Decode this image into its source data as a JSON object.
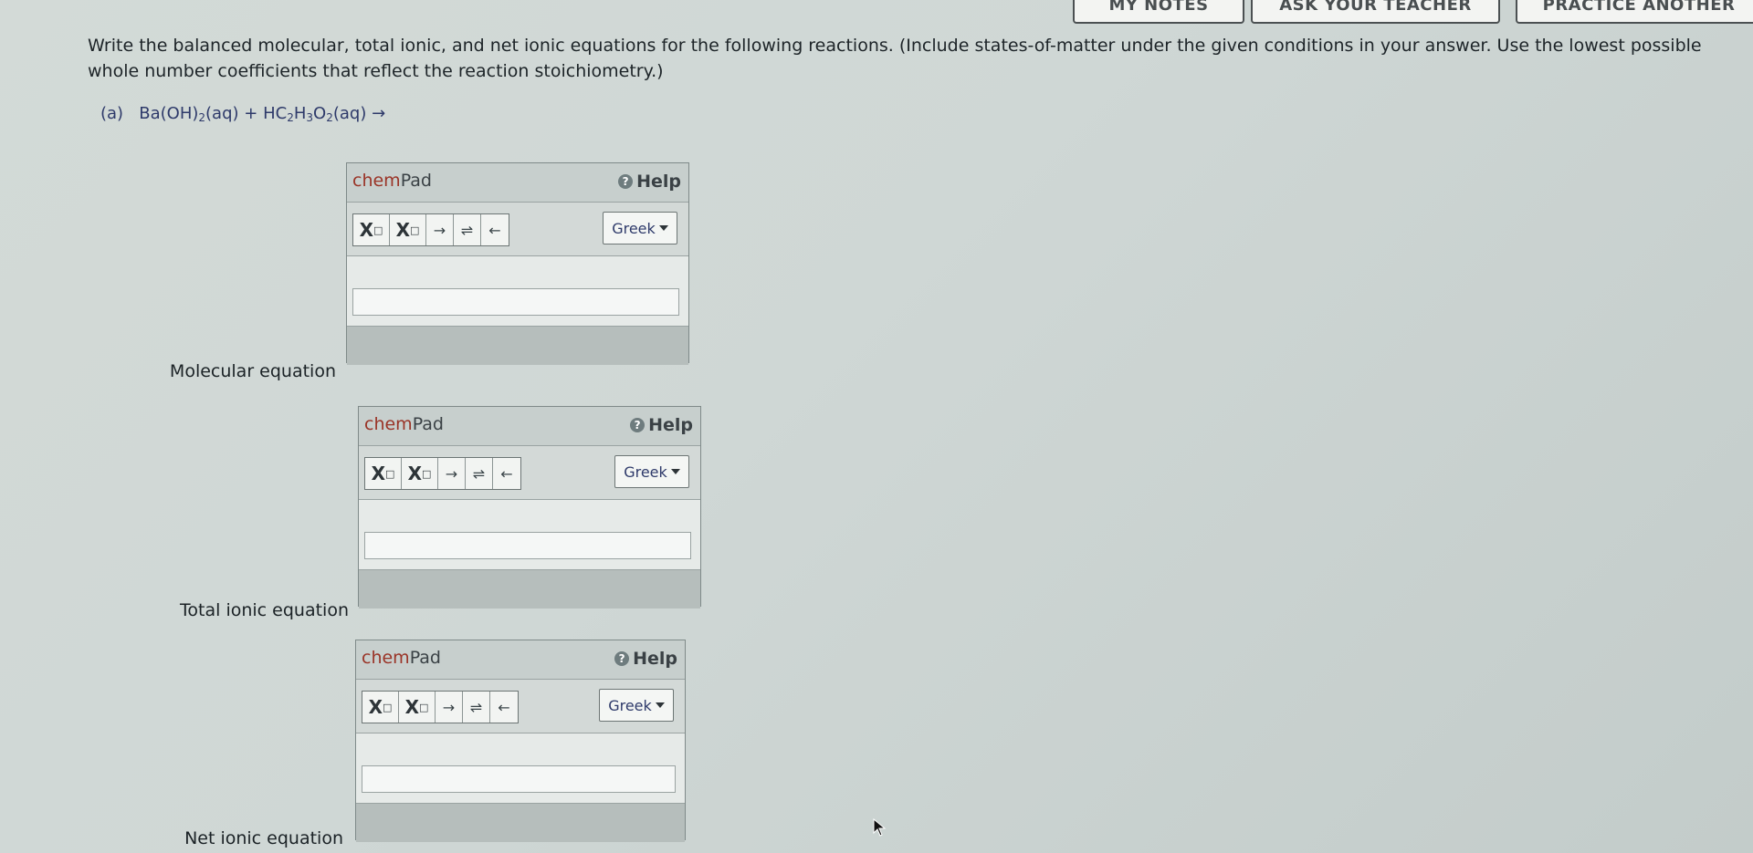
{
  "top_buttons": [
    {
      "label": "MY NOTES"
    },
    {
      "label": "ASK YOUR TEACHER"
    },
    {
      "label": "PRACTICE ANOTHER"
    }
  ],
  "question": {
    "instructions": "Write the balanced molecular, total ionic, and net ionic equations for the following reactions. (Include states-of-matter under the given conditions in your answer. Use the lowest possible whole number coefficients that reflect the reaction stoichiometry.)",
    "part_label": "(a)",
    "reaction": {
      "r1": "Ba(OH)",
      "r1_sub": "2",
      "r1_state": "(aq)",
      "plus": "+",
      "r2_a": "HC",
      "r2_sub1": "2",
      "r2_b": "H",
      "r2_sub2": "3",
      "r2_c": "O",
      "r2_sub3": "2",
      "r2_state": "(aq)",
      "arrow": "→"
    }
  },
  "chempad": {
    "title_chem": "chem",
    "title_pad": "Pad",
    "help_label": "Help",
    "help_icon": "question-circle-icon",
    "subscript_label": "X",
    "superscript_label": "X",
    "box_glyph": "□",
    "arrow_right": "→",
    "equilibrium": "⇌",
    "arrow_left": "←",
    "greek_label": "Greek"
  },
  "equations": [
    {
      "label": "Molecular equation",
      "value": ""
    },
    {
      "label": "Total ionic equation",
      "value": ""
    },
    {
      "label": "Net ionic equation",
      "value": ""
    }
  ]
}
